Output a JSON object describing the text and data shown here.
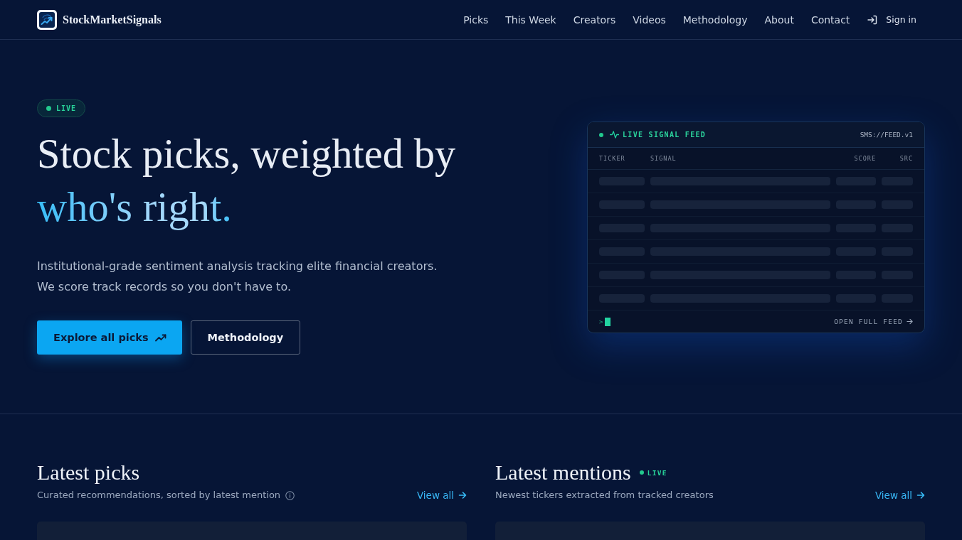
{
  "header": {
    "brand": "StockMarketSignals",
    "nav": [
      {
        "label": "Picks"
      },
      {
        "label": "This Week"
      },
      {
        "label": "Creators"
      },
      {
        "label": "Videos"
      },
      {
        "label": "Methodology"
      },
      {
        "label": "About"
      },
      {
        "label": "Contact"
      }
    ],
    "sign_in": "Sign in"
  },
  "hero": {
    "badge": "LIVE",
    "title": "Stock picks, weighted by",
    "title_accent": "who's right.",
    "description": [
      "Institutional-grade sentiment analysis tracking elite financial creators.",
      "We score track records so you don't have to."
    ],
    "buttons": [
      {
        "label": "Explore all picks",
        "kind": "primary"
      },
      {
        "label": "Methodology",
        "kind": "secondary"
      }
    ]
  },
  "feed": {
    "title": "LIVE SIGNAL FEED",
    "version": "SMS://FEED.v1",
    "columns": [
      "TICKER",
      "SIGNAL",
      "SCORE",
      "SRC"
    ],
    "rows": [
      {
        "kind": "loading"
      },
      {
        "kind": "loading"
      },
      {
        "kind": "loading"
      },
      {
        "kind": "loading"
      },
      {
        "kind": "loading"
      },
      {
        "kind": "loading"
      }
    ],
    "prompt": ">",
    "link": "OPEN FULL FEED"
  },
  "sections": [
    {
      "title": "Latest picks",
      "subtitle": "Curated recommendations, sorted by latest mention",
      "info_icon": true,
      "link": "View all"
    },
    {
      "title": "Latest mentions",
      "badge": "LIVE",
      "subtitle": "Newest tickers extracted from tracked creators",
      "info_icon": false,
      "link": "View all"
    }
  ]
}
